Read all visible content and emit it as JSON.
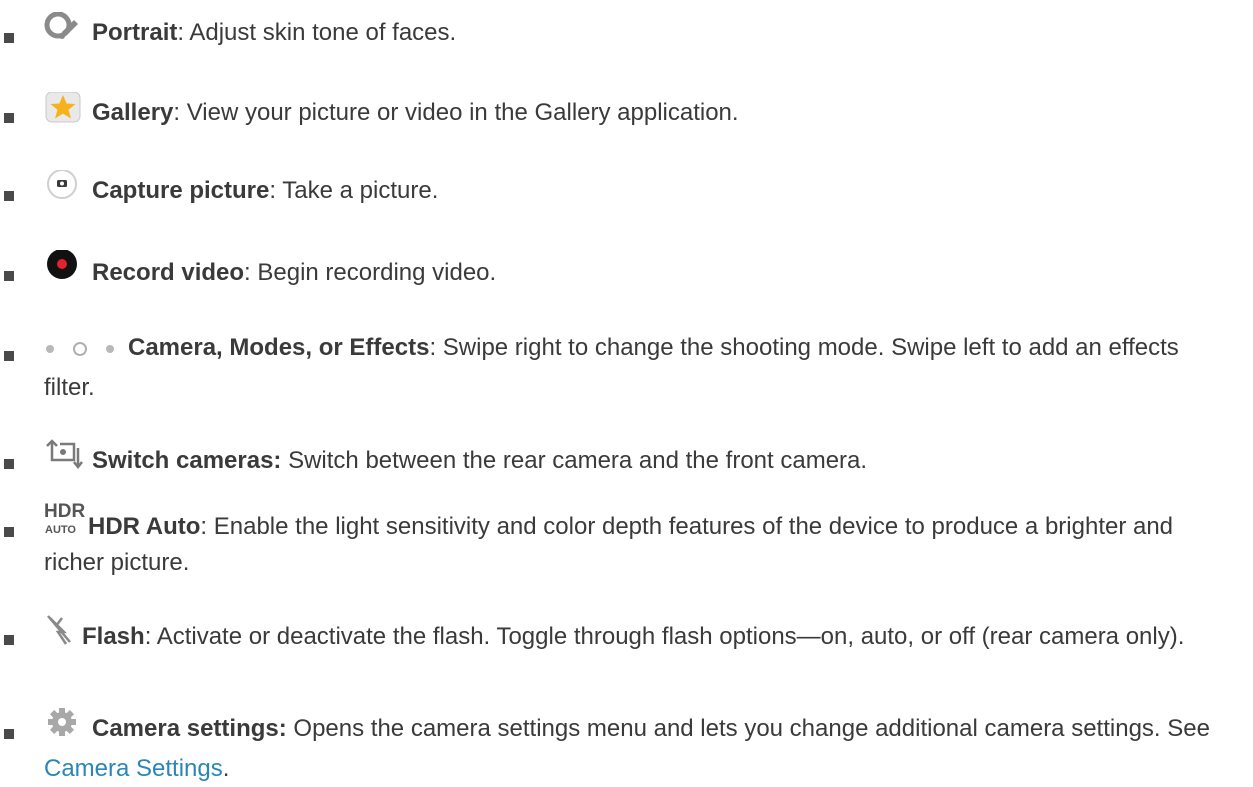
{
  "items": [
    {
      "icon": "portrait-icon",
      "term": "Portrait",
      "desc": ": Adjust skin tone of faces."
    },
    {
      "icon": "gallery-icon",
      "term": "Gallery",
      "desc": ": View your picture or video in the Gallery application."
    },
    {
      "icon": "capture-picture-icon",
      "term": "Capture picture",
      "desc": ": Take a picture."
    },
    {
      "icon": "record-video-icon",
      "term": "Record video",
      "desc": ": Begin recording video."
    },
    {
      "icon": "mode-dots-icon",
      "term": "Camera, Modes, or Effects",
      "desc": ": Swipe right to change the shooting mode. Swipe left to add an effects filter."
    },
    {
      "icon": "switch-cameras-icon",
      "term": "Switch cameras:",
      "desc": " Switch between the rear camera and the front camera."
    },
    {
      "icon": "hdr-auto-icon",
      "icon_text_top": "HDR",
      "icon_text_bottom": "AUTO",
      "term": "HDR Auto",
      "desc": ": Enable the light sensitivity and color depth features of the device to produce a brighter and richer picture."
    },
    {
      "icon": "flash-off-icon",
      "term": "Flash",
      "desc": ": Activate or deactivate the flash. Toggle through flash options—on, auto, or off (rear camera only)."
    },
    {
      "icon": "gear-icon",
      "term": "Camera settings:",
      "desc": " Opens the camera settings menu and lets you change additional camera settings. See ",
      "link": "Camera Settings",
      "after_link": "."
    }
  ],
  "colors": {
    "text": "#3a3a3a",
    "link": "#2a86b8",
    "record_red": "#e3232c",
    "gallery_star": "#f5b21a"
  }
}
